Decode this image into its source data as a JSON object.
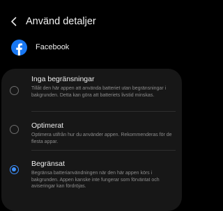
{
  "header": {
    "back_icon": "chevron-left-icon",
    "title": "Använd detaljer"
  },
  "app": {
    "icon": "facebook-icon",
    "name": "Facebook",
    "brand_color": "#1877F2"
  },
  "accent_color": "#3E91FF",
  "options": [
    {
      "title": "Inga begränsningar",
      "description": "Tillåt den här appen att använda batteriet utan begränsningar i bakgrunden. Detta kan göra att batteriets livstid minskas.",
      "selected": false
    },
    {
      "title": "Optimerat",
      "description": "Optimera utifrån hur du använder appen. Rekommenderas för de flesta appar.",
      "selected": false
    },
    {
      "title": "Begränsat",
      "description": "Begränsa batterianvändningen när den här appen körs i bakgrunden. Appen kanske inte fungerar som förväntat och aviseringar kan fördröjas.",
      "selected": true
    }
  ]
}
